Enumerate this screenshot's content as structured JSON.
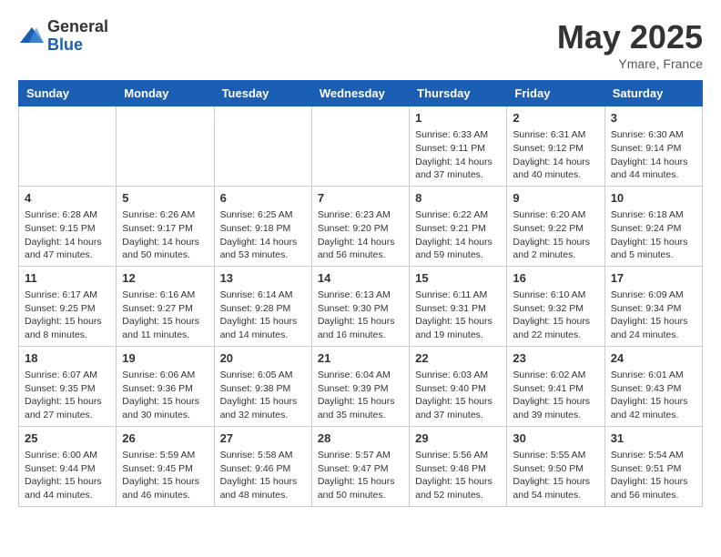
{
  "header": {
    "logo_general": "General",
    "logo_blue": "Blue",
    "month": "May 2025",
    "location": "Ymare, France"
  },
  "weekdays": [
    "Sunday",
    "Monday",
    "Tuesday",
    "Wednesday",
    "Thursday",
    "Friday",
    "Saturday"
  ],
  "weeks": [
    [
      {
        "day": "",
        "content": ""
      },
      {
        "day": "",
        "content": ""
      },
      {
        "day": "",
        "content": ""
      },
      {
        "day": "",
        "content": ""
      },
      {
        "day": "1",
        "content": "Sunrise: 6:33 AM\nSunset: 9:11 PM\nDaylight: 14 hours\nand 37 minutes."
      },
      {
        "day": "2",
        "content": "Sunrise: 6:31 AM\nSunset: 9:12 PM\nDaylight: 14 hours\nand 40 minutes."
      },
      {
        "day": "3",
        "content": "Sunrise: 6:30 AM\nSunset: 9:14 PM\nDaylight: 14 hours\nand 44 minutes."
      }
    ],
    [
      {
        "day": "4",
        "content": "Sunrise: 6:28 AM\nSunset: 9:15 PM\nDaylight: 14 hours\nand 47 minutes."
      },
      {
        "day": "5",
        "content": "Sunrise: 6:26 AM\nSunset: 9:17 PM\nDaylight: 14 hours\nand 50 minutes."
      },
      {
        "day": "6",
        "content": "Sunrise: 6:25 AM\nSunset: 9:18 PM\nDaylight: 14 hours\nand 53 minutes."
      },
      {
        "day": "7",
        "content": "Sunrise: 6:23 AM\nSunset: 9:20 PM\nDaylight: 14 hours\nand 56 minutes."
      },
      {
        "day": "8",
        "content": "Sunrise: 6:22 AM\nSunset: 9:21 PM\nDaylight: 14 hours\nand 59 minutes."
      },
      {
        "day": "9",
        "content": "Sunrise: 6:20 AM\nSunset: 9:22 PM\nDaylight: 15 hours\nand 2 minutes."
      },
      {
        "day": "10",
        "content": "Sunrise: 6:18 AM\nSunset: 9:24 PM\nDaylight: 15 hours\nand 5 minutes."
      }
    ],
    [
      {
        "day": "11",
        "content": "Sunrise: 6:17 AM\nSunset: 9:25 PM\nDaylight: 15 hours\nand 8 minutes."
      },
      {
        "day": "12",
        "content": "Sunrise: 6:16 AM\nSunset: 9:27 PM\nDaylight: 15 hours\nand 11 minutes."
      },
      {
        "day": "13",
        "content": "Sunrise: 6:14 AM\nSunset: 9:28 PM\nDaylight: 15 hours\nand 14 minutes."
      },
      {
        "day": "14",
        "content": "Sunrise: 6:13 AM\nSunset: 9:30 PM\nDaylight: 15 hours\nand 16 minutes."
      },
      {
        "day": "15",
        "content": "Sunrise: 6:11 AM\nSunset: 9:31 PM\nDaylight: 15 hours\nand 19 minutes."
      },
      {
        "day": "16",
        "content": "Sunrise: 6:10 AM\nSunset: 9:32 PM\nDaylight: 15 hours\nand 22 minutes."
      },
      {
        "day": "17",
        "content": "Sunrise: 6:09 AM\nSunset: 9:34 PM\nDaylight: 15 hours\nand 24 minutes."
      }
    ],
    [
      {
        "day": "18",
        "content": "Sunrise: 6:07 AM\nSunset: 9:35 PM\nDaylight: 15 hours\nand 27 minutes."
      },
      {
        "day": "19",
        "content": "Sunrise: 6:06 AM\nSunset: 9:36 PM\nDaylight: 15 hours\nand 30 minutes."
      },
      {
        "day": "20",
        "content": "Sunrise: 6:05 AM\nSunset: 9:38 PM\nDaylight: 15 hours\nand 32 minutes."
      },
      {
        "day": "21",
        "content": "Sunrise: 6:04 AM\nSunset: 9:39 PM\nDaylight: 15 hours\nand 35 minutes."
      },
      {
        "day": "22",
        "content": "Sunrise: 6:03 AM\nSunset: 9:40 PM\nDaylight: 15 hours\nand 37 minutes."
      },
      {
        "day": "23",
        "content": "Sunrise: 6:02 AM\nSunset: 9:41 PM\nDaylight: 15 hours\nand 39 minutes."
      },
      {
        "day": "24",
        "content": "Sunrise: 6:01 AM\nSunset: 9:43 PM\nDaylight: 15 hours\nand 42 minutes."
      }
    ],
    [
      {
        "day": "25",
        "content": "Sunrise: 6:00 AM\nSunset: 9:44 PM\nDaylight: 15 hours\nand 44 minutes."
      },
      {
        "day": "26",
        "content": "Sunrise: 5:59 AM\nSunset: 9:45 PM\nDaylight: 15 hours\nand 46 minutes."
      },
      {
        "day": "27",
        "content": "Sunrise: 5:58 AM\nSunset: 9:46 PM\nDaylight: 15 hours\nand 48 minutes."
      },
      {
        "day": "28",
        "content": "Sunrise: 5:57 AM\nSunset: 9:47 PM\nDaylight: 15 hours\nand 50 minutes."
      },
      {
        "day": "29",
        "content": "Sunrise: 5:56 AM\nSunset: 9:48 PM\nDaylight: 15 hours\nand 52 minutes."
      },
      {
        "day": "30",
        "content": "Sunrise: 5:55 AM\nSunset: 9:50 PM\nDaylight: 15 hours\nand 54 minutes."
      },
      {
        "day": "31",
        "content": "Sunrise: 5:54 AM\nSunset: 9:51 PM\nDaylight: 15 hours\nand 56 minutes."
      }
    ]
  ]
}
